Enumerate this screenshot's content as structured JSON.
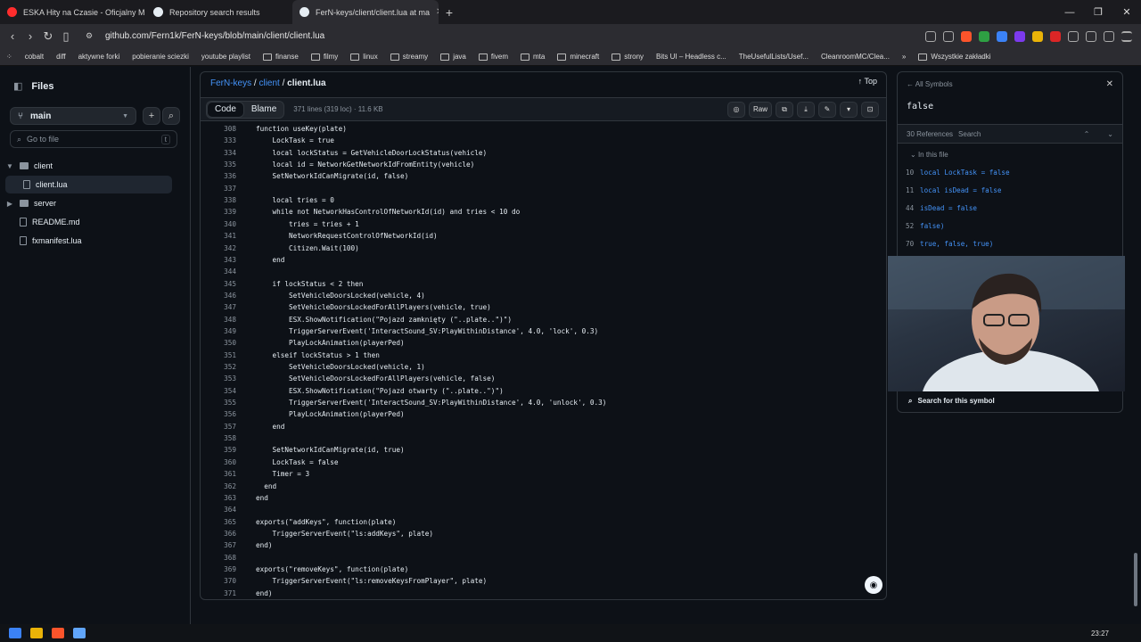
{
  "browser": {
    "tabs": [
      {
        "title": "ESKA Hity na Czasie - Oficjalny M",
        "icon_color": "#ff2d2d"
      },
      {
        "title": "Repository search results",
        "icon_color": "#e6edf3"
      },
      {
        "title": "FerN-keys/client/client.lua at ma",
        "icon_color": "#e6edf3"
      }
    ],
    "url": "github.com/Fern1k/FerN-keys/blob/main/client/client.lua",
    "bookmarks": [
      "cobalt",
      "diff",
      "aktywne forki",
      "pobieranie sciezki",
      "youtube playlist",
      "finanse",
      "filmy",
      "linux",
      "streamy",
      "java",
      "fivem",
      "mta",
      "minecraft",
      "strony",
      "Bits UI – Headless c...",
      "TheUsefulLists/Usef...",
      "CleanroomMC/Clea..."
    ],
    "bookmarks_more": "»",
    "all_bookmarks": "Wszystkie zakładki"
  },
  "sidebar": {
    "title": "Files",
    "branch": "main",
    "goto_placeholder": "Go to file",
    "goto_key": "t",
    "tree": [
      {
        "label": "client",
        "type": "folder",
        "indent": 0,
        "open": true
      },
      {
        "label": "client.lua",
        "type": "file",
        "indent": 1,
        "selected": true
      },
      {
        "label": "server",
        "type": "folder",
        "indent": 0,
        "open": false
      },
      {
        "label": "README.md",
        "type": "file",
        "indent": 0
      },
      {
        "label": "fxmanifest.lua",
        "type": "file",
        "indent": 0
      }
    ]
  },
  "file": {
    "repo": "FerN-keys",
    "dir": "client",
    "name": "client.lua",
    "top_label": "Top",
    "code_tab": "Code",
    "blame_tab": "Blame",
    "meta": "371 lines (319 loc) · 11.6 KB",
    "raw_label": "Raw"
  },
  "code_lines": [
    {
      "n": "308",
      "t": "function useKey(plate)"
    },
    {
      "n": "333",
      "t": "    LockTask = true"
    },
    {
      "n": "334",
      "t": "    local lockStatus = GetVehicleDoorLockStatus(vehicle)"
    },
    {
      "n": "335",
      "t": "    local id = NetworkGetNetworkIdFromEntity(vehicle)"
    },
    {
      "n": "336",
      "t": "    SetNetworkIdCanMigrate(id, false)"
    },
    {
      "n": "337",
      "t": ""
    },
    {
      "n": "338",
      "t": "    local tries = 0"
    },
    {
      "n": "339",
      "t": "    while not NetworkHasControlOfNetworkId(id) and tries < 10 do"
    },
    {
      "n": "340",
      "t": "        tries = tries + 1"
    },
    {
      "n": "341",
      "t": "        NetworkRequestControlOfNetworkId(id)"
    },
    {
      "n": "342",
      "t": "        Citizen.Wait(100)"
    },
    {
      "n": "343",
      "t": "    end"
    },
    {
      "n": "344",
      "t": ""
    },
    {
      "n": "345",
      "t": "    if lockStatus < 2 then"
    },
    {
      "n": "346",
      "t": "        SetVehicleDoorsLocked(vehicle, 4)"
    },
    {
      "n": "347",
      "t": "        SetVehicleDoorsLockedForAllPlayers(vehicle, true)"
    },
    {
      "n": "348",
      "t": "        ESX.ShowNotification(\"Pojazd zamknięty (\"..plate..\")\")"
    },
    {
      "n": "349",
      "t": "        TriggerServerEvent('InteractSound_SV:PlayWithinDistance', 4.0, 'lock', 0.3)"
    },
    {
      "n": "350",
      "t": "        PlayLockAnimation(playerPed)"
    },
    {
      "n": "351",
      "t": "    elseif lockStatus > 1 then"
    },
    {
      "n": "352",
      "t": "        SetVehicleDoorsLocked(vehicle, 1)"
    },
    {
      "n": "353",
      "t": "        SetVehicleDoorsLockedForAllPlayers(vehicle, false)"
    },
    {
      "n": "354",
      "t": "        ESX.ShowNotification(\"Pojazd otwarty (\"..plate..\")\")"
    },
    {
      "n": "355",
      "t": "        TriggerServerEvent('InteractSound_SV:PlayWithinDistance', 4.0, 'unlock', 0.3)"
    },
    {
      "n": "356",
      "t": "        PlayLockAnimation(playerPed)"
    },
    {
      "n": "357",
      "t": "    end"
    },
    {
      "n": "358",
      "t": ""
    },
    {
      "n": "359",
      "t": "    SetNetworkIdCanMigrate(id, true)"
    },
    {
      "n": "360",
      "t": "    LockTask = false"
    },
    {
      "n": "361",
      "t": "    Timer = 3"
    },
    {
      "n": "362",
      "t": "  end"
    },
    {
      "n": "363",
      "t": "end"
    },
    {
      "n": "364",
      "t": ""
    },
    {
      "n": "365",
      "t": "exports(\"addKeys\", function(plate)"
    },
    {
      "n": "366",
      "t": "    TriggerServerEvent(\"ls:addKeys\", plate)"
    },
    {
      "n": "367",
      "t": "end)"
    },
    {
      "n": "368",
      "t": ""
    },
    {
      "n": "369",
      "t": "exports(\"removeKeys\", function(plate)"
    },
    {
      "n": "370",
      "t": "    TriggerServerEvent(\"ls:removeKeysFromPlayer\", plate)"
    },
    {
      "n": "371",
      "t": "end)"
    }
  ],
  "symbols": {
    "back_label": "All Symbols",
    "symbol": "false",
    "refs_count": "30 References",
    "refs_search": "Search",
    "in_file": "In this file",
    "refs": [
      {
        "n": "10",
        "t": "local LockTask = false"
      },
      {
        "n": "11",
        "t": "local isDead = false"
      },
      {
        "n": "44",
        "t": "isDead = false"
      },
      {
        "n": "52",
        "t": "false)"
      },
      {
        "n": "70",
        "t": "true, false, true)"
      }
    ],
    "search_label": "Search for this symbol"
  },
  "taskbar": {
    "clock": "23:27"
  }
}
